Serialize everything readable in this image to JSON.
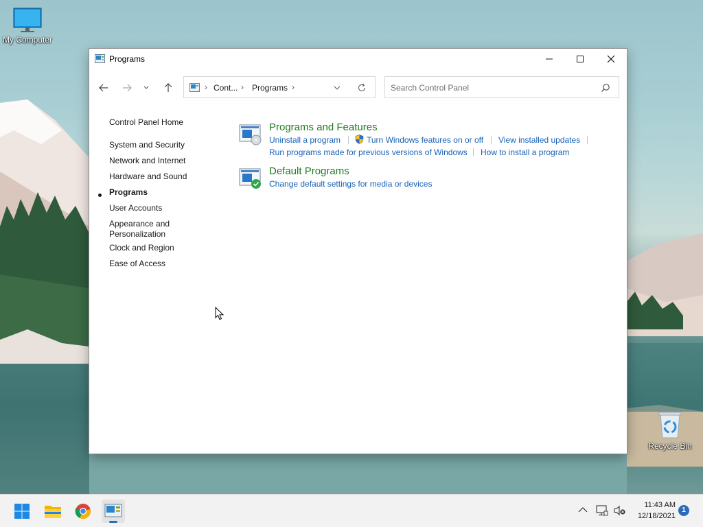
{
  "desktop": {
    "icons": [
      {
        "label": "My Computer",
        "icon": "monitor-icon"
      },
      {
        "label": "Recycle Bin",
        "icon": "recycle-bin-icon"
      }
    ]
  },
  "window": {
    "title": "Programs",
    "controls": [
      "minimize",
      "maximize",
      "close"
    ],
    "breadcrumb": [
      "Cont...",
      "Programs"
    ],
    "search_placeholder": "Search Control Panel",
    "sidebar": {
      "home": "Control Panel Home",
      "items": [
        {
          "label": "System and Security"
        },
        {
          "label": "Network and Internet"
        },
        {
          "label": "Hardware and Sound"
        },
        {
          "label": "Programs",
          "active": true
        },
        {
          "label": "User Accounts"
        },
        {
          "label": "Appearance and Personalization",
          "lines": [
            "Appearance and",
            "Personalization"
          ]
        },
        {
          "label": "Clock and Region"
        },
        {
          "label": "Ease of Access"
        }
      ]
    },
    "categories": [
      {
        "title": "Programs and Features",
        "links": [
          "Uninstall a program",
          "Turn Windows features on or off",
          "View installed updates",
          "Run programs made for previous versions of Windows",
          "How to install a program"
        ]
      },
      {
        "title": "Default Programs",
        "links": [
          "Change default settings for media or devices"
        ]
      }
    ]
  },
  "taskbar": {
    "apps": [
      "start-icon",
      "file-explorer-icon",
      "chrome-icon",
      "control-panel-icon"
    ],
    "clock": {
      "time": "11:43 AM",
      "date": "12/18/2021"
    },
    "notification_count": "1"
  },
  "colors": {
    "category_title": "#1e7a1e",
    "link": "#1661b8",
    "taskbar_bg": "#f2f2f2",
    "accent": "#2b6cb8"
  }
}
